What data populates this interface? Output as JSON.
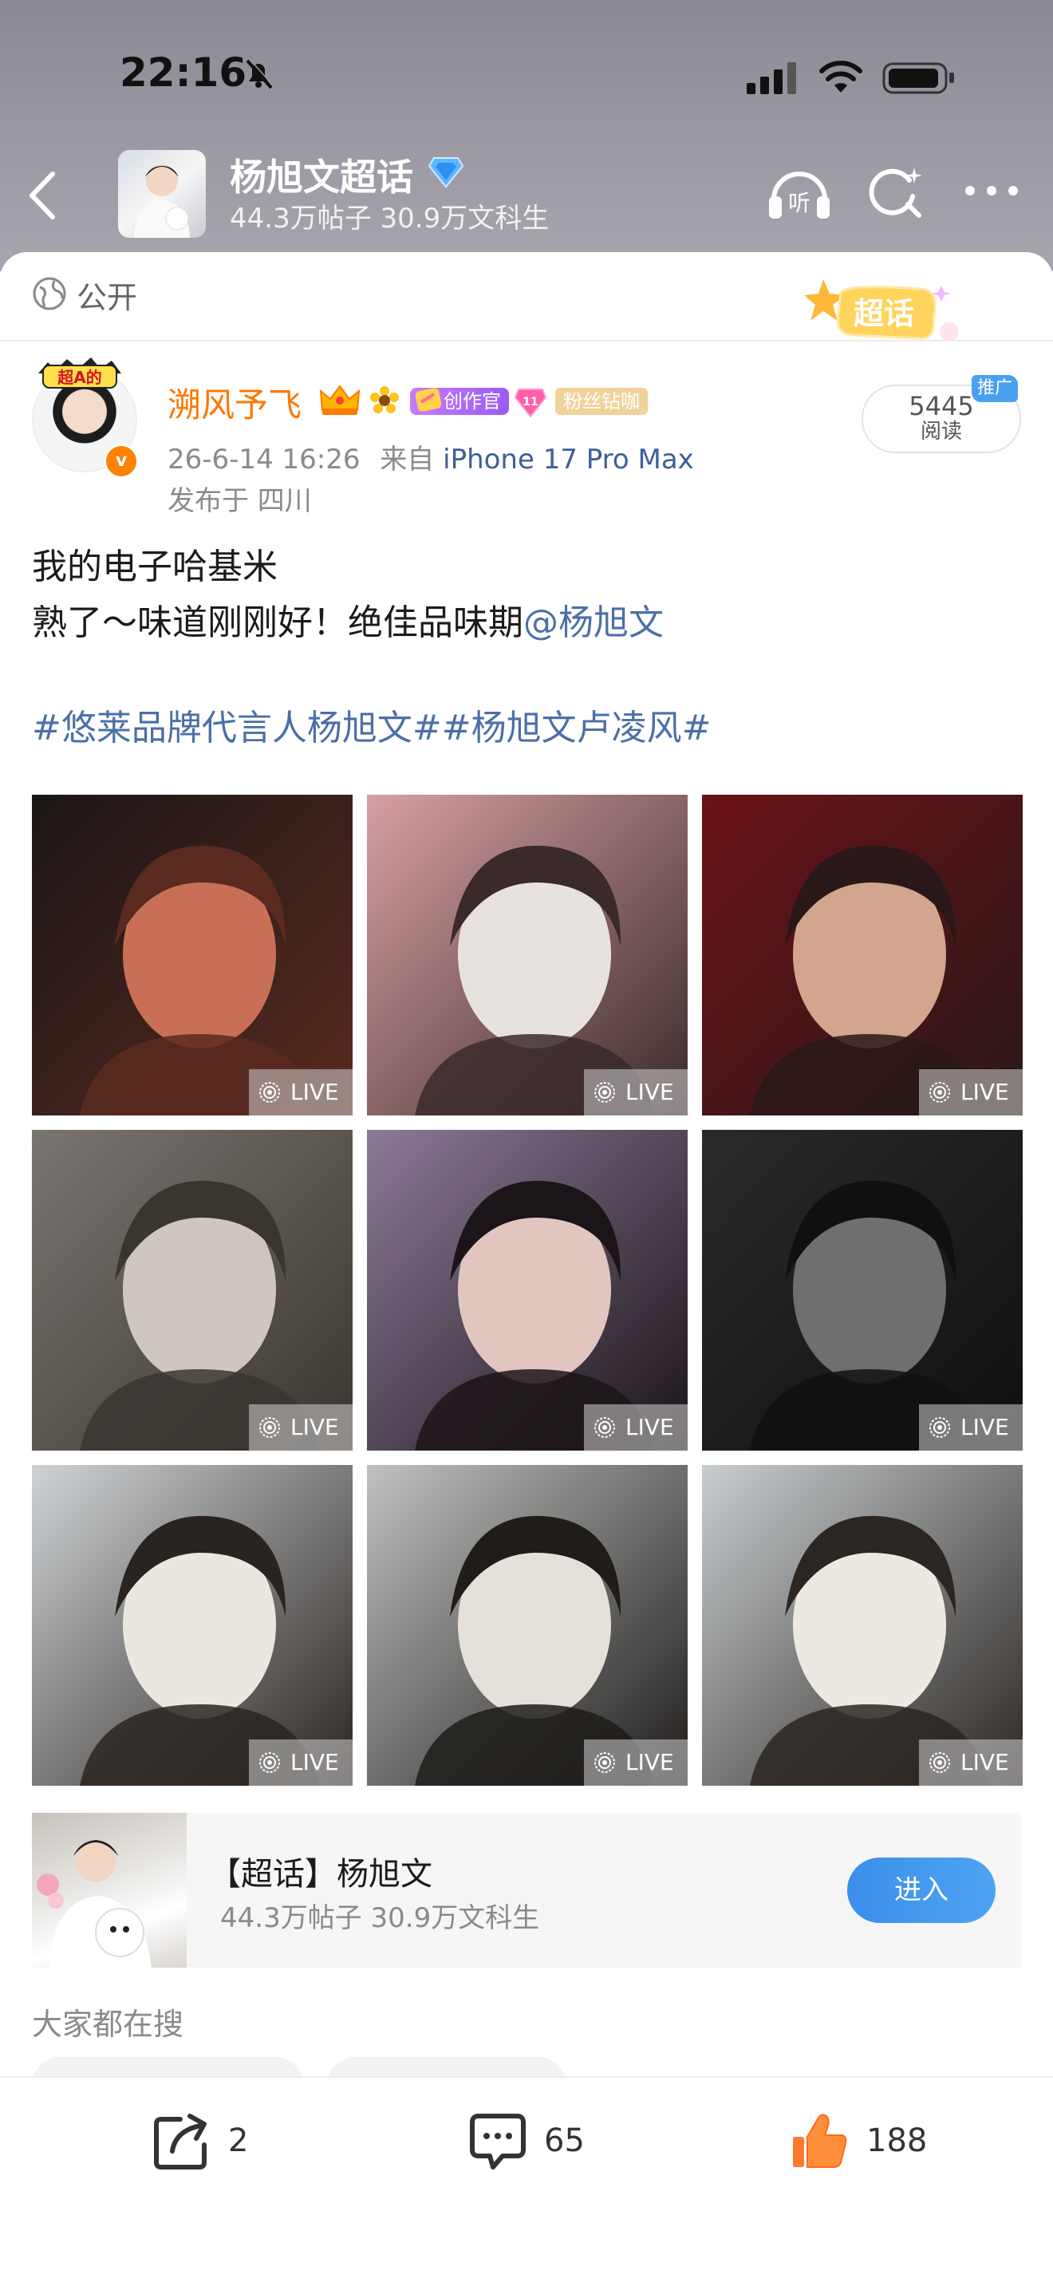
{
  "status_bar": {
    "time": "22:16"
  },
  "nav": {
    "title": "杨旭文超话",
    "subtitle": "44.3万帖子 30.9万文科生"
  },
  "post": {
    "visibility": "公开",
    "sticker_text": "超话",
    "author": {
      "name": "溯风予飞",
      "avatar_sticker": "超A的",
      "creator_badge": "创作官",
      "fan_badge": "粉丝钻咖",
      "verified": "v"
    },
    "meta": {
      "time": "26-6-14 16:26",
      "from_prefix": "来自",
      "device": "iPhone 17 Pro Max",
      "location": "发布于 四川"
    },
    "reads": {
      "count": "5445",
      "label": "阅读",
      "promo": "推广"
    },
    "text_line1": "我的电子哈基米",
    "text_line2": "熟了～味道刚刚好！绝佳品味期",
    "mention": "@杨旭文",
    "hashtags": "#悠莱品牌代言人杨旭文##杨旭文卢凌风#",
    "photos": [
      {
        "live": "LIVE",
        "colors": [
          "#1a1616",
          "#5a2a20",
          "#c96f55"
        ]
      },
      {
        "live": "LIVE",
        "colors": [
          "#d7a0a4",
          "#3a2a2a",
          "#e8e2df"
        ]
      },
      {
        "live": "LIVE",
        "colors": [
          "#6a1218",
          "#2a1818",
          "#d3a48e"
        ]
      },
      {
        "live": "LIVE",
        "colors": [
          "#7a7570",
          "#3b3530",
          "#cfc7bf"
        ]
      },
      {
        "live": "LIVE",
        "colors": [
          "#8b7a98",
          "#1b1418",
          "#e0c6bf"
        ]
      },
      {
        "live": "LIVE",
        "colors": [
          "#2a2a2a",
          "#101010",
          "#6f6f6f"
        ]
      },
      {
        "live": "LIVE",
        "colors": [
          "#cfd3d6",
          "#2a2420",
          "#eae6e0"
        ]
      },
      {
        "live": "LIVE",
        "colors": [
          "#bfc2c0",
          "#1f1c1a",
          "#e5e1da"
        ]
      },
      {
        "live": "LIVE",
        "colors": [
          "#c9ced1",
          "#2b2622",
          "#ece8e2"
        ]
      }
    ]
  },
  "topic_card": {
    "title": "【超话】杨旭文",
    "subtitle": "44.3万帖子 30.9万文科生",
    "button": "进入"
  },
  "search_section": {
    "heading": "大家都在搜"
  },
  "actions": {
    "share_count": "2",
    "comment_count": "65",
    "like_count": "188"
  }
}
